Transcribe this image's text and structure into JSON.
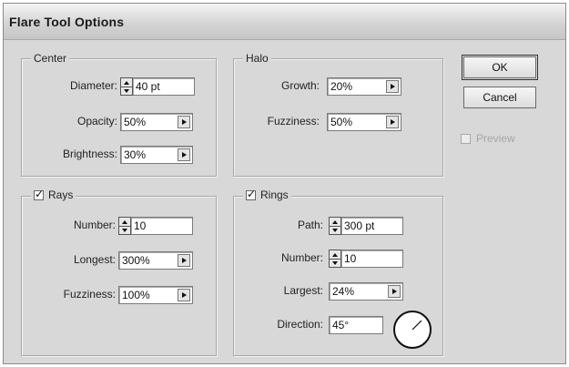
{
  "title": "Flare Tool Options",
  "center": {
    "label": "Center",
    "diameter_label": "Diameter:",
    "diameter_value": "40 pt",
    "opacity_label": "Opacity:",
    "opacity_value": "50%",
    "brightness_label": "Brightness:",
    "brightness_value": "30%"
  },
  "halo": {
    "label": "Halo",
    "growth_label": "Growth:",
    "growth_value": "20%",
    "fuzziness_label": "Fuzziness:",
    "fuzziness_value": "50%"
  },
  "rays": {
    "label": "Rays",
    "checked": true,
    "number_label": "Number:",
    "number_value": "10",
    "longest_label": "Longest:",
    "longest_value": "300%",
    "fuzziness_label": "Fuzziness:",
    "fuzziness_value": "100%"
  },
  "rings": {
    "label": "Rings",
    "checked": true,
    "path_label": "Path:",
    "path_value": "300 pt",
    "number_label": "Number:",
    "number_value": "10",
    "largest_label": "Largest:",
    "largest_value": "24%",
    "direction_label": "Direction:",
    "direction_value": "45°",
    "direction_degrees": 45
  },
  "buttons": {
    "ok": "OK",
    "cancel": "Cancel"
  },
  "preview": {
    "label": "Preview",
    "checked": false
  }
}
